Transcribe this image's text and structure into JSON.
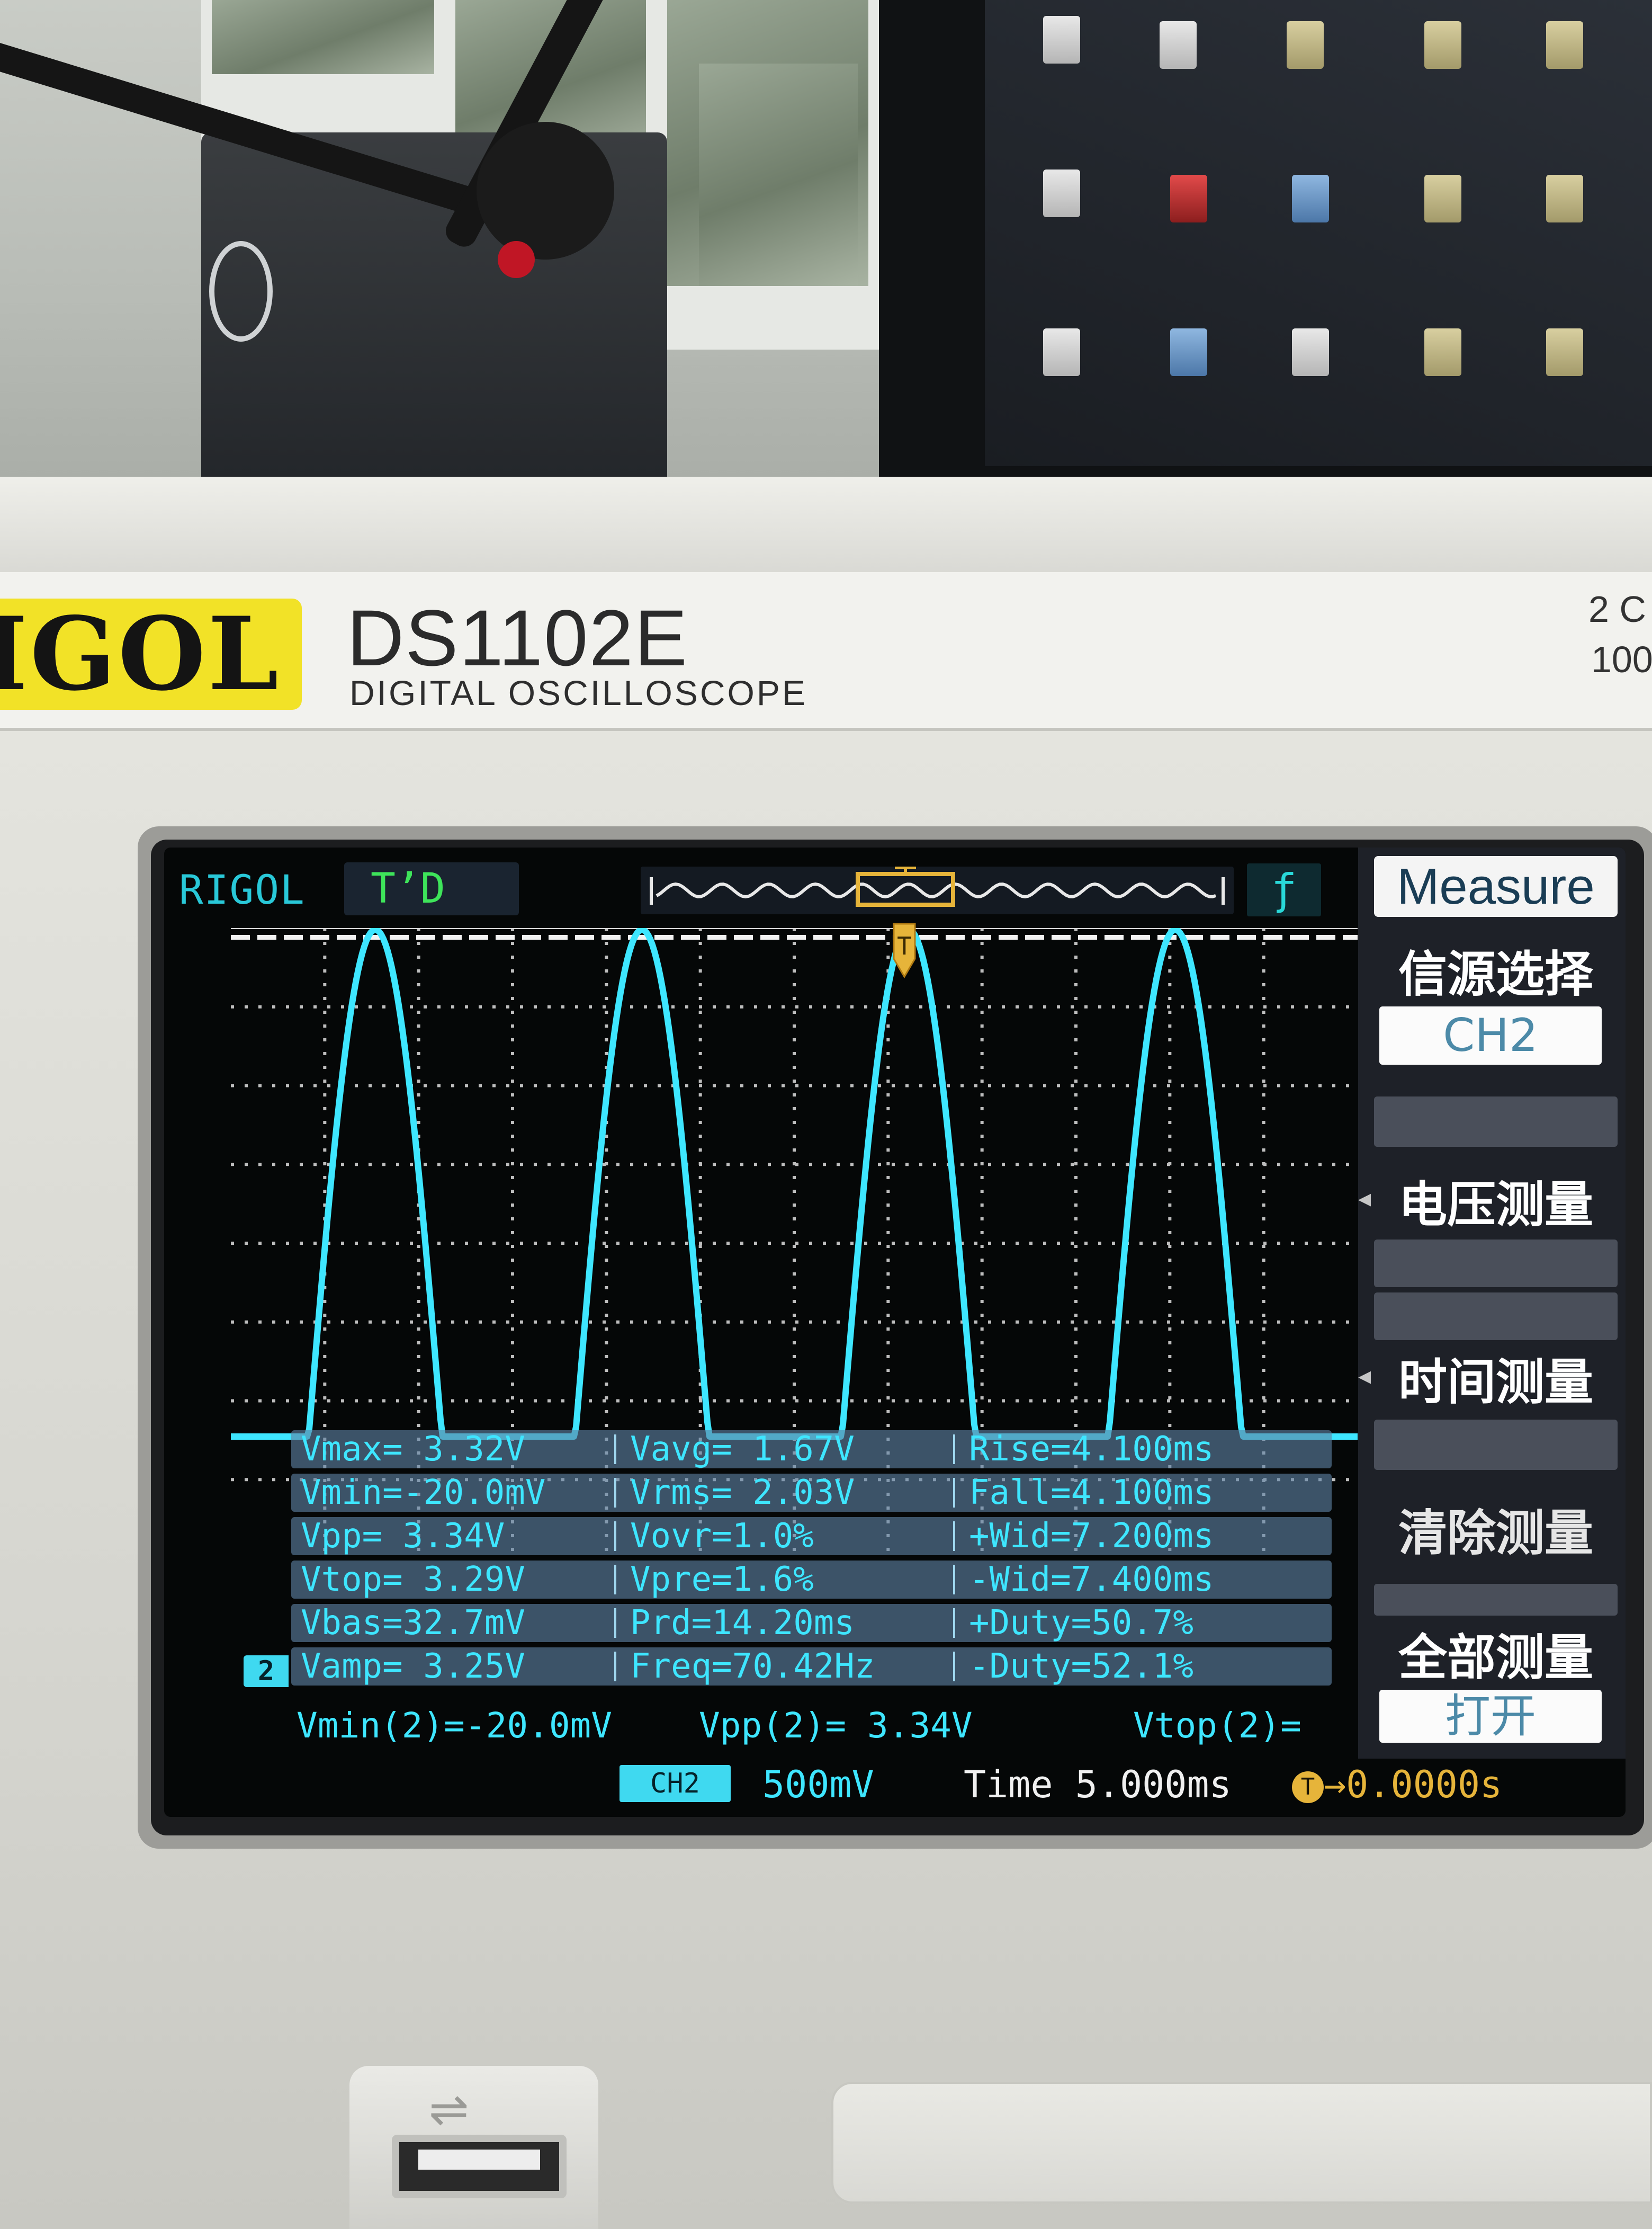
{
  "device": {
    "brand": "IGOL",
    "model": "DS1102E",
    "subtitle": "DIGITAL OSCILLOSCOPE",
    "spec_line_1": "2 C",
    "spec_line_2": "100"
  },
  "screen": {
    "brand": "RIGOL",
    "run_state": "T’D",
    "trigger_edge_symbol": "ƒ",
    "channel_marker": "2",
    "colors": {
      "trace": "#3ee6ff",
      "trigger": "#e6b43a",
      "run_state": "#3ee45a"
    }
  },
  "menu": {
    "title": "Measure",
    "items": [
      {
        "label": "信源选择",
        "value": "CH2"
      },
      {
        "label": "电压测量",
        "value": ""
      },
      {
        "label": "时间测量",
        "value": ""
      },
      {
        "label": "清除测量",
        "value": ""
      },
      {
        "label": "全部测量",
        "value": "打开"
      }
    ]
  },
  "measurements": [
    [
      "Vmax= 3.32V",
      "Vavg= 1.67V",
      "Rise=4.100ms"
    ],
    [
      "Vmin=-20.0mV",
      "Vrms= 2.03V",
      "Fall=4.100ms"
    ],
    [
      "Vpp= 3.34V",
      "Vovr=1.0%",
      "+Wid=7.200ms"
    ],
    [
      "Vtop= 3.29V",
      "Vpre=1.6%",
      "-Wid=7.400ms"
    ],
    [
      "Vbas=32.7mV",
      "Prd=14.20ms",
      "+Duty=50.7%"
    ],
    [
      "Vamp= 3.25V",
      "Freq=70.42Hz",
      "-Duty=52.1%"
    ]
  ],
  "measure_line": {
    "item1": "Vmin(2)=-20.0mV",
    "item2": "Vpp(2)= 3.34V",
    "item3": "Vtop(2)="
  },
  "status": {
    "channel": "CH2",
    "volts_per_div": "500mV",
    "timebase": "Time 5.000ms",
    "trigger_offset": "0.0000s",
    "trigger_icon": "T"
  },
  "waveform": {
    "type": "half-wave rectified sine",
    "period_divs": 2.84,
    "peak_divs": 6.6,
    "cursor_level_divs": 6.5
  }
}
